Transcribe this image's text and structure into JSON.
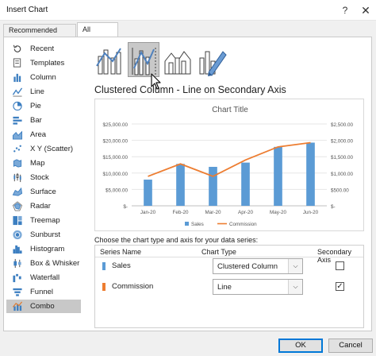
{
  "window": {
    "title": "Insert Chart",
    "help": "?",
    "close": "✕"
  },
  "tabs": [
    {
      "label": "Recommended Charts",
      "selected": false
    },
    {
      "label": "All Charts",
      "selected": true
    }
  ],
  "sidebar": {
    "items": [
      {
        "label": "Recent",
        "icon": "recent-icon"
      },
      {
        "label": "Templates",
        "icon": "templates-icon"
      },
      {
        "label": "Column",
        "icon": "column-chart-icon"
      },
      {
        "label": "Line",
        "icon": "line-chart-icon"
      },
      {
        "label": "Pie",
        "icon": "pie-chart-icon"
      },
      {
        "label": "Bar",
        "icon": "bar-chart-icon"
      },
      {
        "label": "Area",
        "icon": "area-chart-icon"
      },
      {
        "label": "X Y (Scatter)",
        "icon": "scatter-chart-icon"
      },
      {
        "label": "Map",
        "icon": "map-chart-icon"
      },
      {
        "label": "Stock",
        "icon": "stock-chart-icon"
      },
      {
        "label": "Surface",
        "icon": "surface-chart-icon"
      },
      {
        "label": "Radar",
        "icon": "radar-chart-icon"
      },
      {
        "label": "Treemap",
        "icon": "treemap-chart-icon"
      },
      {
        "label": "Sunburst",
        "icon": "sunburst-chart-icon"
      },
      {
        "label": "Histogram",
        "icon": "histogram-chart-icon"
      },
      {
        "label": "Box & Whisker",
        "icon": "box-whisker-chart-icon"
      },
      {
        "label": "Waterfall",
        "icon": "waterfall-chart-icon"
      },
      {
        "label": "Funnel",
        "icon": "funnel-chart-icon"
      },
      {
        "label": "Combo",
        "icon": "combo-chart-icon"
      }
    ],
    "selected": "Combo"
  },
  "combo_types": {
    "thumbnails": [
      "clustered-column-line-icon",
      "clustered-column-line-secondary-icon",
      "stacked-area-column-icon",
      "custom-combination-icon"
    ],
    "selected": "clustered-column-line-secondary-icon",
    "heading": "Clustered Column - Line on Secondary Axis"
  },
  "chart_data": {
    "type": "bar",
    "title": "Chart Title",
    "categories": [
      "Jan-20",
      "Feb-20",
      "Mar-20",
      "Apr-20",
      "May-20",
      "Jun-20"
    ],
    "series": [
      {
        "name": "Sales",
        "type": "bar",
        "axis": "primary",
        "color": "#5b9bd5",
        "values": [
          8000,
          12800,
          11900,
          13200,
          18000,
          19300
        ]
      },
      {
        "name": "Commission",
        "type": "line",
        "axis": "secondary",
        "color": "#ed7d31",
        "values": [
          900,
          1280,
          900,
          1400,
          1800,
          1930
        ]
      }
    ],
    "y_ticks": [
      "$25,000.00",
      "$20,000.00",
      "$15,000.00",
      "$10,000.00",
      "$5,000.00",
      "$-"
    ],
    "y2_ticks": [
      "$2,500.00",
      "$2,000.00",
      "$1,500.00",
      "$1,000.00",
      "$500.00",
      "$-"
    ],
    "ylim": [
      0,
      25000
    ],
    "y2lim": [
      0,
      2500
    ],
    "legend_position": "bottom"
  },
  "series_table": {
    "caption": "Choose the chart type and axis for your data series:",
    "headers": {
      "name": "Series Name",
      "type": "Chart Type",
      "secondary": "Secondary Axis"
    },
    "rows": [
      {
        "name": "Sales",
        "color": "#5b9bd5",
        "chart_type": "Clustered Column",
        "secondary": false
      },
      {
        "name": "Commission",
        "color": "#ed7d31",
        "chart_type": "Line",
        "secondary": true
      }
    ],
    "checked_mark": "✓",
    "dropdown_arrow": "⌵"
  },
  "buttons": {
    "ok": "OK",
    "cancel": "Cancel"
  }
}
